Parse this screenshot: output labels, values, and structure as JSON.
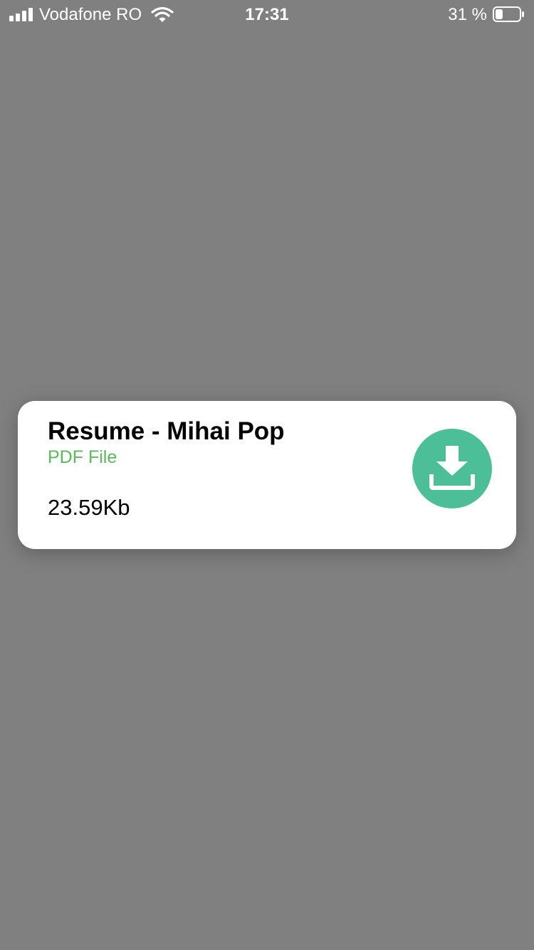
{
  "status_bar": {
    "carrier": "Vodafone RO",
    "time": "17:31",
    "battery_percent": "31 %",
    "battery_level": 0.31,
    "signal_icon": "signal-bars-icon",
    "wifi_icon": "wifi-icon",
    "battery_icon": "battery-icon"
  },
  "file_card": {
    "title": "Resume - Mihai Pop",
    "type": "PDF File",
    "size": "23.59Kb",
    "download_icon": "download-icon"
  },
  "colors": {
    "background": "#808080",
    "card": "#ffffff",
    "file_type_text": "#5cb85c",
    "download_button": "#4cbf99"
  }
}
